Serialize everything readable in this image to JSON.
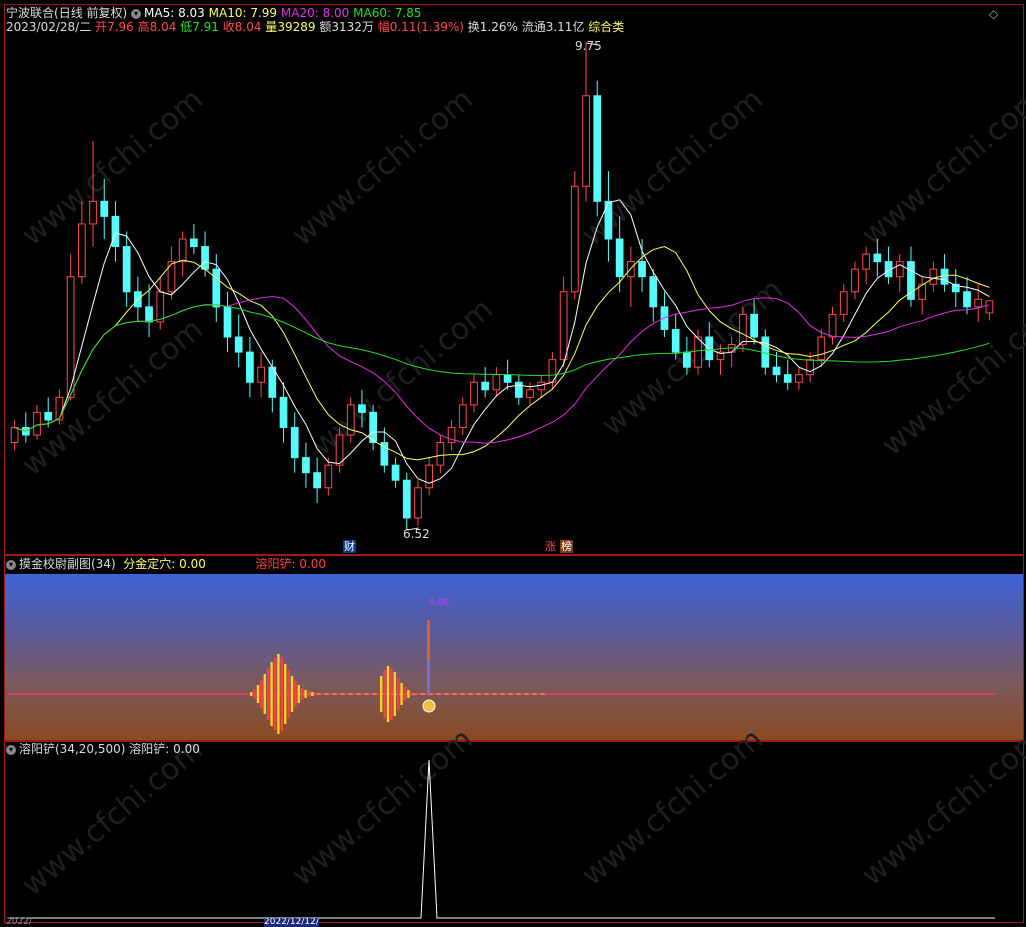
{
  "header": {
    "stock_name": "宁波联合",
    "period": "(日线 前复权)",
    "ma5_label": "MA5: 8.03",
    "ma10_label": "MA10: 7.99",
    "ma20_label": "MA20: 8.00",
    "ma60_label": "MA60: 7.85",
    "date": "2023/02/28/二",
    "open_label": "开",
    "open_val": "7.96",
    "high_label": "高",
    "high_val": "8.04",
    "low_label": "低",
    "low_val": "7.91",
    "close_label": "收",
    "close_val": "8.04",
    "vol_label": "量",
    "vol_val": "39289",
    "amount_label": "额",
    "amount_val": "3132万",
    "change_label": "幅",
    "change_val": "0.11(1.39%)",
    "turnover": "换1.26%",
    "float_cap": "流通3.11亿",
    "category": "综合类"
  },
  "markers": {
    "high_price": "9.75",
    "low_price": "6.52",
    "finance_tag": "财",
    "zhang_tag": "涨",
    "bang_tag": "榜"
  },
  "sub1": {
    "title": "摸金校尉副图(34)",
    "label1": "分金定穴: 0.00",
    "label2": "溶阳铲: 0.00",
    "peak_label": "0.00"
  },
  "sub2": {
    "title": "溶阳铲(34,20,500)",
    "label1": "溶阳铲: 0.00"
  },
  "bottom": {
    "date_left": "2022/",
    "date_mid": "2022/12/12/"
  },
  "watermark": "www.cfchi.com",
  "colors": {
    "up": "#ff4a4a",
    "down": "#54fcfc",
    "ma5": "#ffffff",
    "ma10": "#ffff66",
    "ma20": "#e030e0",
    "ma60": "#20e020",
    "frame": "#a01818",
    "baseline": "#ff3070",
    "bar_yellow": "#ffd020",
    "bar_red": "#ff4040"
  },
  "chart_data": {
    "type": "candlestick",
    "price_axis": {
      "max": 9.75,
      "min": 6.52
    },
    "ma_periods": [
      5,
      10,
      20,
      60
    ],
    "candles": [
      [
        7.1,
        7.25,
        7.05,
        7.2
      ],
      [
        7.2,
        7.3,
        7.1,
        7.15
      ],
      [
        7.15,
        7.35,
        7.12,
        7.3
      ],
      [
        7.3,
        7.4,
        7.2,
        7.25
      ],
      [
        7.25,
        7.45,
        7.22,
        7.4
      ],
      [
        7.4,
        8.35,
        7.38,
        8.2
      ],
      [
        8.2,
        8.7,
        8.15,
        8.55
      ],
      [
        8.55,
        9.1,
        8.4,
        8.7
      ],
      [
        8.7,
        8.85,
        8.45,
        8.6
      ],
      [
        8.6,
        8.7,
        8.3,
        8.4
      ],
      [
        8.4,
        8.5,
        8.0,
        8.1
      ],
      [
        8.1,
        8.2,
        7.9,
        8.0
      ],
      [
        8.0,
        8.15,
        7.8,
        7.9
      ],
      [
        7.9,
        8.2,
        7.85,
        8.1
      ],
      [
        8.1,
        8.4,
        8.05,
        8.3
      ],
      [
        8.3,
        8.5,
        8.2,
        8.45
      ],
      [
        8.45,
        8.55,
        8.35,
        8.4
      ],
      [
        8.4,
        8.5,
        8.2,
        8.25
      ],
      [
        8.25,
        8.35,
        7.9,
        8.0
      ],
      [
        8.0,
        8.1,
        7.7,
        7.8
      ],
      [
        7.8,
        7.95,
        7.6,
        7.7
      ],
      [
        7.7,
        7.8,
        7.4,
        7.5
      ],
      [
        7.5,
        7.7,
        7.4,
        7.6
      ],
      [
        7.6,
        7.65,
        7.3,
        7.4
      ],
      [
        7.4,
        7.5,
        7.1,
        7.2
      ],
      [
        7.2,
        7.3,
        6.9,
        7.0
      ],
      [
        7.0,
        7.1,
        6.8,
        6.9
      ],
      [
        6.9,
        7.0,
        6.7,
        6.8
      ],
      [
        6.8,
        7.0,
        6.75,
        6.95
      ],
      [
        6.95,
        7.2,
        6.9,
        7.15
      ],
      [
        7.15,
        7.4,
        7.1,
        7.35
      ],
      [
        7.35,
        7.45,
        7.2,
        7.3
      ],
      [
        7.3,
        7.35,
        7.05,
        7.1
      ],
      [
        7.1,
        7.2,
        6.9,
        6.95
      ],
      [
        6.95,
        7.0,
        6.8,
        6.85
      ],
      [
        6.85,
        6.9,
        6.52,
        6.6
      ],
      [
        6.6,
        6.85,
        6.55,
        6.8
      ],
      [
        6.8,
        7.0,
        6.75,
        6.95
      ],
      [
        6.95,
        7.15,
        6.9,
        7.1
      ],
      [
        7.1,
        7.25,
        7.05,
        7.2
      ],
      [
        7.2,
        7.4,
        7.15,
        7.35
      ],
      [
        7.35,
        7.55,
        7.3,
        7.5
      ],
      [
        7.5,
        7.6,
        7.4,
        7.45
      ],
      [
        7.45,
        7.6,
        7.4,
        7.55
      ],
      [
        7.55,
        7.65,
        7.45,
        7.5
      ],
      [
        7.5,
        7.55,
        7.35,
        7.4
      ],
      [
        7.4,
        7.5,
        7.35,
        7.45
      ],
      [
        7.45,
        7.55,
        7.4,
        7.5
      ],
      [
        7.5,
        7.7,
        7.45,
        7.65
      ],
      [
        7.65,
        8.2,
        7.6,
        8.1
      ],
      [
        8.1,
        8.9,
        8.05,
        8.8
      ],
      [
        8.8,
        9.75,
        8.7,
        9.4
      ],
      [
        9.4,
        9.5,
        8.6,
        8.7
      ],
      [
        8.7,
        8.9,
        8.3,
        8.45
      ],
      [
        8.45,
        8.6,
        8.1,
        8.2
      ],
      [
        8.2,
        8.4,
        8.0,
        8.3
      ],
      [
        8.3,
        8.45,
        8.1,
        8.2
      ],
      [
        8.2,
        8.25,
        7.9,
        8.0
      ],
      [
        8.0,
        8.1,
        7.8,
        7.85
      ],
      [
        7.85,
        7.95,
        7.65,
        7.7
      ],
      [
        7.7,
        7.8,
        7.55,
        7.6
      ],
      [
        7.6,
        7.85,
        7.55,
        7.8
      ],
      [
        7.8,
        7.9,
        7.6,
        7.65
      ],
      [
        7.65,
        7.75,
        7.55,
        7.7
      ],
      [
        7.7,
        7.8,
        7.6,
        7.75
      ],
      [
        7.75,
        8.0,
        7.7,
        7.95
      ],
      [
        7.95,
        8.05,
        7.75,
        7.8
      ],
      [
        7.8,
        7.85,
        7.55,
        7.6
      ],
      [
        7.6,
        7.7,
        7.5,
        7.55
      ],
      [
        7.55,
        7.65,
        7.45,
        7.5
      ],
      [
        7.5,
        7.6,
        7.45,
        7.55
      ],
      [
        7.55,
        7.7,
        7.5,
        7.65
      ],
      [
        7.65,
        7.85,
        7.6,
        7.8
      ],
      [
        7.8,
        8.0,
        7.75,
        7.95
      ],
      [
        7.95,
        8.15,
        7.9,
        8.1
      ],
      [
        8.1,
        8.3,
        8.05,
        8.25
      ],
      [
        8.25,
        8.4,
        8.15,
        8.35
      ],
      [
        8.35,
        8.45,
        8.2,
        8.3
      ],
      [
        8.3,
        8.4,
        8.15,
        8.2
      ],
      [
        8.2,
        8.35,
        8.1,
        8.3
      ],
      [
        8.3,
        8.4,
        8.0,
        8.05
      ],
      [
        8.05,
        8.2,
        7.95,
        8.15
      ],
      [
        8.15,
        8.3,
        8.1,
        8.25
      ],
      [
        8.25,
        8.35,
        8.1,
        8.15
      ],
      [
        8.15,
        8.25,
        8.0,
        8.1
      ],
      [
        8.1,
        8.2,
        7.95,
        8.0
      ],
      [
        8.0,
        8.15,
        7.9,
        8.05
      ],
      [
        7.96,
        8.04,
        7.91,
        8.04
      ]
    ],
    "sub1_bars": [
      {
        "group": 1,
        "heights": [
          2,
          5,
          9,
          14,
          20,
          26,
          32,
          36,
          40,
          37,
          30,
          24,
          18,
          13,
          9,
          6,
          4,
          3,
          2,
          1
        ]
      },
      {
        "group": 2,
        "heights": [
          18,
          24,
          28,
          26,
          22,
          16,
          11,
          7,
          4,
          2
        ]
      }
    ],
    "sub1_spike": {
      "value": 0.0
    },
    "sub2_spike": {
      "value": 0.0
    }
  }
}
